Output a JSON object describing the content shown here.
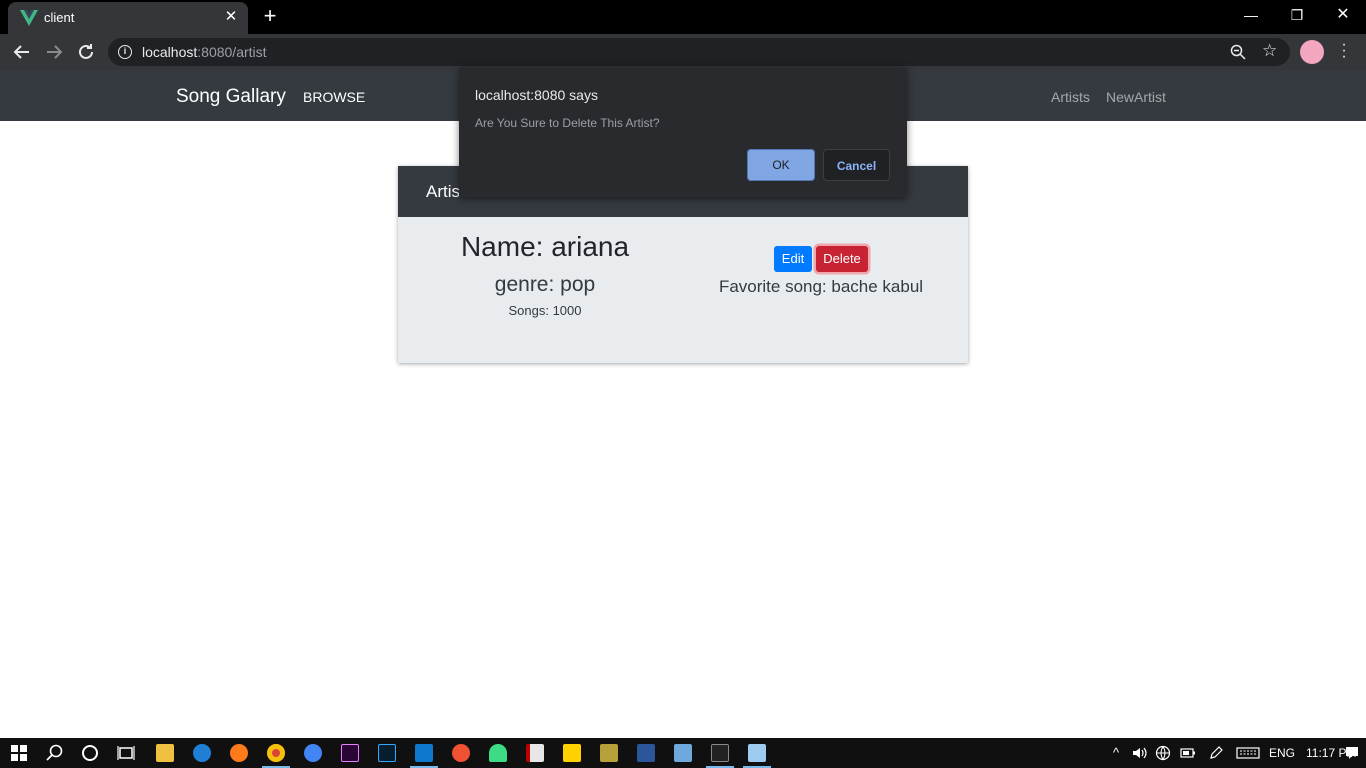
{
  "browser": {
    "tab_title": "client",
    "new_tab_glyph": "+",
    "tab_close_glyph": "✕",
    "window_controls": {
      "minimize": "—",
      "restore": "❐",
      "close": "✕"
    },
    "url_host": "localhost",
    "url_rest": ":8080/artist",
    "star_glyph": "☆",
    "menu_glyph": "⋮",
    "accent": "#35363a"
  },
  "app": {
    "brand": "Song Gallary",
    "browse": "BROWSE",
    "nav_links": [
      "Artists",
      "NewArtist"
    ]
  },
  "card": {
    "header_title": "Artis",
    "name": "Name: ariana",
    "genre": "genre: pop",
    "songs": "Songs: 1000",
    "edit_label": "Edit",
    "delete_label": "Delete",
    "favorite": "Favorite song: bache kabul"
  },
  "dialog": {
    "origin": "localhost:8080 says",
    "message": "Are You Sure to Delete This Artist?",
    "ok_label": "OK",
    "cancel_label": "Cancel"
  },
  "taskbar": {
    "language": "ENG",
    "time": "11:17 PM",
    "apps": [
      "file-explorer-icon",
      "edge-icon",
      "firefox-icon",
      "chrome-icon",
      "chrome-alt-icon",
      "premiere-icon",
      "photoshop-icon",
      "vscode-icon",
      "git-icon",
      "android-icon",
      "filezilla-icon",
      "sticky-notes-icon",
      "winrar-icon",
      "word-icon",
      "control-panel-icon",
      "cmd-icon",
      "notepad-icon"
    ]
  }
}
